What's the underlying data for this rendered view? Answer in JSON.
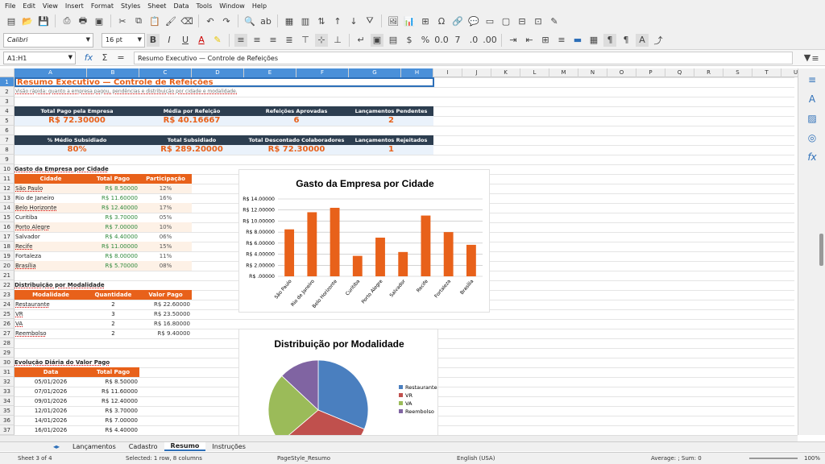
{
  "menu": [
    "File",
    "Edit",
    "View",
    "Insert",
    "Format",
    "Styles",
    "Sheet",
    "Data",
    "Tools",
    "Window",
    "Help"
  ],
  "font_name": "Calibri",
  "font_size": "16 pt",
  "name_box": "A1:H1",
  "formula_text": "Resumo Executivo — Controle de Refeições",
  "columns": [
    "A",
    "B",
    "C",
    "D",
    "E",
    "F",
    "G",
    "H",
    "I",
    "J",
    "K",
    "L",
    "M",
    "N",
    "O",
    "P",
    "Q",
    "R",
    "S",
    "T",
    "U"
  ],
  "rows": [
    "1",
    "2",
    "3",
    "4",
    "5",
    "6",
    "7",
    "8",
    "9",
    "10",
    "11",
    "12",
    "13",
    "14",
    "15",
    "16",
    "17",
    "18",
    "19",
    "20",
    "21",
    "22",
    "23",
    "24",
    "25",
    "26",
    "27",
    "28",
    "29",
    "30",
    "31",
    "32",
    "33",
    "34",
    "35",
    "36",
    "37"
  ],
  "title": "Resumo Executivo — Controle de Refeições",
  "subtitle": "Visão rápida: quanto a empresa pagou, pendências e distribuição por cidade e modalidade.",
  "kpi1": {
    "labels": [
      "Total Pago pela Empresa",
      "Média por Refeição",
      "Refeições Aprovadas",
      "Lançamentos Pendentes"
    ],
    "values": [
      "R$ 72.30000",
      "R$ 40.16667",
      "6",
      "2"
    ]
  },
  "kpi2": {
    "labels": [
      "% Médio Subsidiado",
      "Total Subsidiado",
      "Total Descontado Colaboradores",
      "Lançamentos Rejeitados"
    ],
    "values": [
      "80%",
      "R$ 289.20000",
      "R$ 72.30000",
      "1"
    ]
  },
  "city_section": "Gasto da Empresa por Cidade",
  "city_headers": [
    "Cidade",
    "Total Pago",
    "Participação"
  ],
  "cities": [
    [
      "São Paulo",
      "R$ 8.50000",
      "12%"
    ],
    [
      "Rio de Janeiro",
      "R$ 11.60000",
      "16%"
    ],
    [
      "Belo Horizonte",
      "R$ 12.40000",
      "17%"
    ],
    [
      "Curitiba",
      "R$ 3.70000",
      "05%"
    ],
    [
      "Porto Alegre",
      "R$ 7.00000",
      "10%"
    ],
    [
      "Salvador",
      "R$ 4.40000",
      "06%"
    ],
    [
      "Recife",
      "R$ 11.00000",
      "15%"
    ],
    [
      "Fortaleza",
      "R$ 8.00000",
      "11%"
    ],
    [
      "Brasília",
      "R$ 5.70000",
      "08%"
    ]
  ],
  "mod_section": "Distribuição por Modalidade",
  "mod_headers": [
    "Modalidade",
    "Quantidade",
    "Valor Pago"
  ],
  "mods": [
    [
      "Restaurante",
      "2",
      "R$ 22.60000"
    ],
    [
      "VR",
      "3",
      "R$ 23.50000"
    ],
    [
      "VA",
      "2",
      "R$ 16.80000"
    ],
    [
      "Reembolso",
      "2",
      "R$ 9.40000"
    ]
  ],
  "daily_section": "Evolução Diária do Valor Pago",
  "daily_headers": [
    "Data",
    "Total Pago"
  ],
  "daily": [
    [
      "05/01/2026",
      "R$ 8.50000"
    ],
    [
      "07/01/2026",
      "R$ 11.60000"
    ],
    [
      "09/01/2026",
      "R$ 12.40000"
    ],
    [
      "12/01/2026",
      "R$ 3.70000"
    ],
    [
      "14/01/2026",
      "R$ 7.00000"
    ],
    [
      "16/01/2026",
      "R$ 4.40000"
    ]
  ],
  "chart_data": [
    {
      "type": "bar",
      "title": "Gasto da Empresa por Cidade",
      "categories": [
        "São Paulo",
        "Rio de Janeiro",
        "Belo Horizonte",
        "Curitiba",
        "Porto Alegre",
        "Salvador",
        "Recife",
        "Fortaleza",
        "Brasília"
      ],
      "values": [
        8.5,
        11.6,
        12.4,
        3.7,
        7.0,
        4.4,
        11.0,
        8.0,
        5.7
      ],
      "ylim": [
        0,
        14
      ],
      "yticks": [
        "R$ 14.00000",
        "R$ 12.00000",
        "R$ 10.00000",
        "R$ 8.00000",
        "R$ 6.00000",
        "R$ 4.00000",
        "R$ 2.00000",
        "R$ .00000"
      ],
      "color": "#e8611a"
    },
    {
      "type": "pie",
      "title": "Distribuição por Modalidade",
      "categories": [
        "Restaurante",
        "VR",
        "VA",
        "Reembolso"
      ],
      "values": [
        22.6,
        23.5,
        16.8,
        9.4
      ],
      "colors": [
        "#4a7fbf",
        "#c0504d",
        "#9bbb59",
        "#8064a2"
      ]
    }
  ],
  "tabs": [
    "Lançamentos",
    "Cadastro",
    "Resumo",
    "Instruções"
  ],
  "status": {
    "sheet": "Sheet 3 of 4",
    "selected": "Selected: 1 row, 8 columns",
    "style": "PageStyle_Resumo",
    "lang": "English (USA)",
    "avg": "Average: ; Sum: 0",
    "zoom": "100%"
  }
}
